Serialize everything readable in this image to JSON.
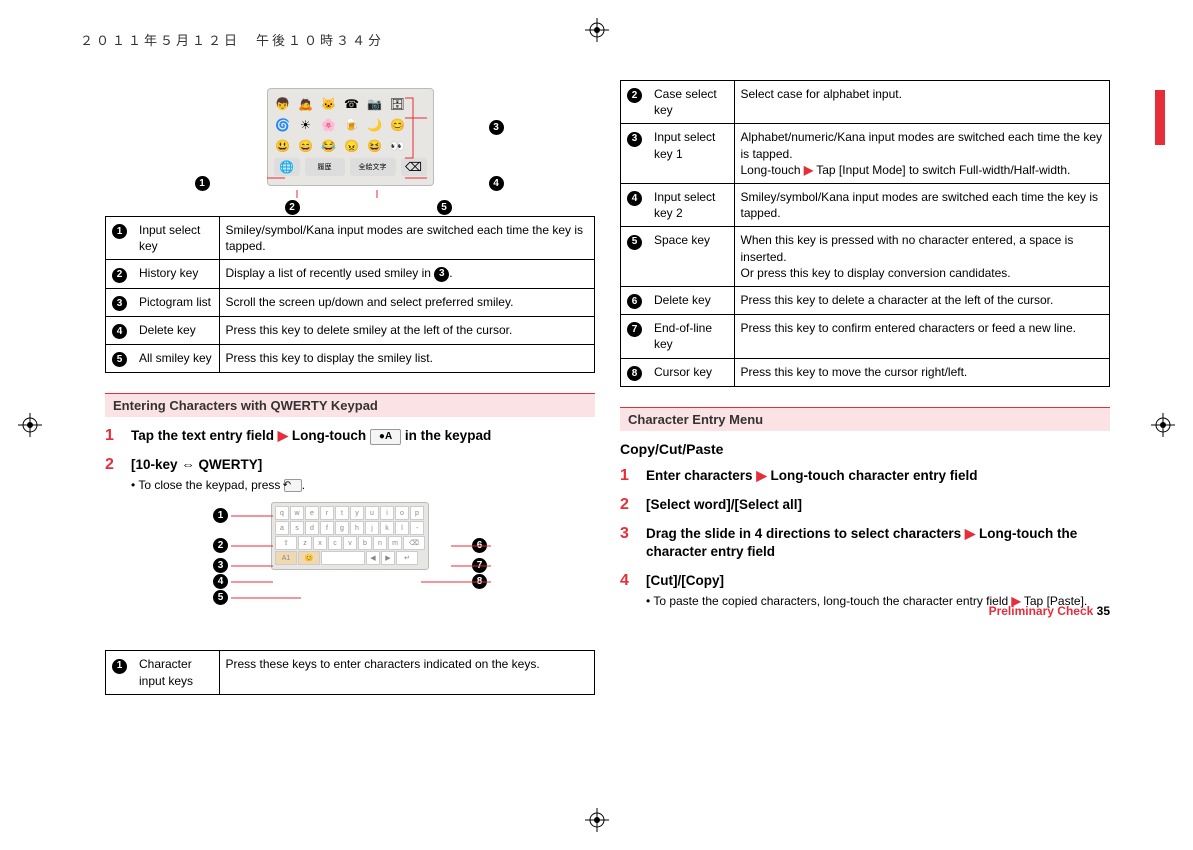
{
  "header": {
    "date": "２０１１年５月１２日　午後１０時３４分"
  },
  "table_smiley": [
    {
      "n": "❶",
      "label": "Input select key",
      "desc": "Smiley/symbol/Kana input modes are switched each time the key is tapped."
    },
    {
      "n": "❷",
      "label": "History key",
      "desc": "Display a list of recently used smiley in ❸."
    },
    {
      "n": "❸",
      "label": "Pictogram list",
      "desc": "Scroll the screen up/down and select preferred smiley."
    },
    {
      "n": "❹",
      "label": "Delete key",
      "desc": "Press this key to delete smiley at the left of the cursor."
    },
    {
      "n": "❺",
      "label": "All smiley key",
      "desc": "Press this key to display the smiley list."
    }
  ],
  "section_qwerty": {
    "title": "Entering Characters with QWERTY Keypad",
    "step1": {
      "num": "1",
      "text_a": "Tap the text entry field ",
      "text_b": " Long-touch ",
      "text_c": " in the keypad"
    },
    "step2": {
      "num": "2",
      "title": "[10-key ⇔ QWERTY]",
      "sub": "To close the keypad, press "
    }
  },
  "table_qwerty": [
    {
      "n": "❶",
      "label": "Character input keys",
      "desc": "Press these keys to enter characters indicated on the keys."
    }
  ],
  "table_qwerty_right": [
    {
      "n": "❷",
      "label": "Case select key",
      "desc": "Select case for alphabet input."
    },
    {
      "n": "❸",
      "label": "Input select key 1",
      "desc": "Alphabet/numeric/Kana input modes are switched each time the key is tapped.\nLong-touch ▶ Tap [Input Mode] to switch Full-width/Half-width."
    },
    {
      "n": "❹",
      "label": "Input select key 2",
      "desc": "Smiley/symbol/Kana input modes are switched each time the key is tapped."
    },
    {
      "n": "❺",
      "label": "Space key",
      "desc": "When this key is pressed with no character entered, a space is inserted.\nOr press this key to display conversion candidates."
    },
    {
      "n": "❻",
      "label": "Delete key",
      "desc": "Press this key to delete a character at the left of the cursor."
    },
    {
      "n": "❼",
      "label": "End-of-line key",
      "desc": "Press this key to confirm entered characters or feed a new line."
    },
    {
      "n": "❽",
      "label": "Cursor key",
      "desc": "Press this key to move the cursor right/left."
    }
  ],
  "section_char": {
    "title": "Character Entry Menu",
    "subhead": "Copy/Cut/Paste",
    "step1": {
      "num": "1",
      "a": "Enter characters ",
      "b": " Long-touch character entry field"
    },
    "step2": {
      "num": "2",
      "t": "[Select word]/[Select all]"
    },
    "step3": {
      "num": "3",
      "a": "Drag the slide in 4 directions to select characters ",
      "b": " Long-touch the character entry field"
    },
    "step4": {
      "num": "4",
      "t": "[Cut]/[Copy]",
      "sub_a": "To paste the copied characters, long-touch the character entry field ",
      "sub_b": " Tap [Paste]."
    }
  },
  "footer": {
    "label": "Preliminary Check",
    "page": "35"
  },
  "qwerty_keys": {
    "r1": [
      "q",
      "w",
      "e",
      "r",
      "t",
      "y",
      "u",
      "i",
      "o",
      "p"
    ],
    "r2": [
      "a",
      "s",
      "d",
      "f",
      "g",
      "h",
      "j",
      "k",
      "l",
      "-"
    ],
    "r3": [
      "z",
      "x",
      "c",
      "v",
      "b",
      "n",
      "m"
    ]
  }
}
